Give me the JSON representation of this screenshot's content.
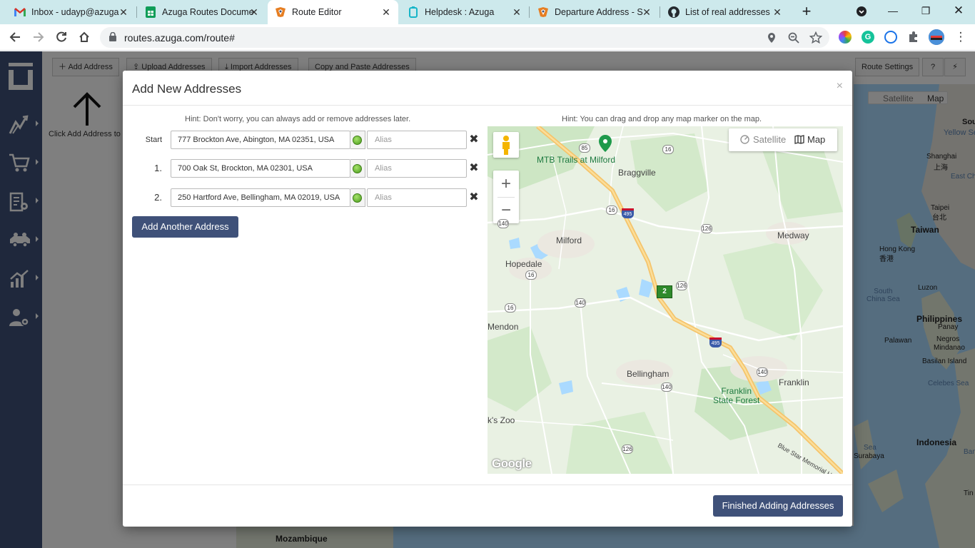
{
  "browser": {
    "tabs": [
      {
        "title": "Inbox - udayp@azuga",
        "icon": "gmail-icon",
        "color": "#d93025"
      },
      {
        "title": "Azuga Routes Docume",
        "icon": "sheets-icon",
        "color": "#0f9d58"
      },
      {
        "title": "Route Editor",
        "icon": "azuga-icon",
        "color": "#e67e22"
      },
      {
        "title": "Helpdesk : Azuga",
        "icon": "helpdesk-icon",
        "color": "#17b5c8"
      },
      {
        "title": "Departure Address - S",
        "icon": "azuga-icon",
        "color": "#e67e22"
      },
      {
        "title": "List of real addresses",
        "icon": "github-icon",
        "color": "#24292e"
      }
    ],
    "url": "routes.azuga.com/route#"
  },
  "app": {
    "toolbar": {
      "add_address": "Add Address",
      "upload_addresses": "Upload Addresses",
      "import_addresses": "Import Addresses",
      "copy_paste": "Copy and Paste Addresses",
      "route_settings": "Route Settings",
      "help": "?",
      "flash": "⚡"
    },
    "hint_left": "Click Add Address to",
    "bg_map": {
      "satellite": "Satellite",
      "map": "Map",
      "labels": {
        "south": "Sout",
        "yellow_sea": "Yellow Sea",
        "shanghai": "Shanghai",
        "shanghai_cn": "上海",
        "east_china": "East China",
        "taipei": "Taipei",
        "taipei_cn": "台北",
        "taiwan": "Taiwan",
        "hong_kong": "Hong Kong",
        "hong_kong_cn": "香港",
        "south_china_sea": "South\nChina Sea",
        "luzon": "Luzon",
        "philippines": "Philippines",
        "panay": "Panay",
        "palawan": "Palawan",
        "negros": "Negros",
        "mindanao": "Mindanao",
        "basilan": "Basilan Island",
        "celebes": "Celebes Sea",
        "sea": "Sea",
        "surabaya": "Surabaya",
        "indonesia": "Indonesia",
        "banda": "Banda",
        "tin": "Tin",
        "mozambique": "Mozambique"
      }
    }
  },
  "modal": {
    "title": "Add New Addresses",
    "close": "×",
    "hint_left": "Hint: Don't worry, you can always add or remove addresses later.",
    "hint_right": "Hint: You can drag and drop any map marker on the map.",
    "rows": [
      {
        "label": "Start",
        "address": "777 Brockton Ave, Abington, MA 02351, USA",
        "alias_placeholder": "Alias"
      },
      {
        "label": "1.",
        "address": "700 Oak St, Brockton, MA 02301, USA",
        "alias_placeholder": "Alias"
      },
      {
        "label": "2.",
        "address": "250 Hartford Ave, Bellingham, MA 02019, USA",
        "alias_placeholder": "Alias"
      }
    ],
    "add_another": "Add Another Address",
    "finished": "Finished Adding Addresses"
  },
  "map": {
    "satellite": "Satellite",
    "map": "Map",
    "zoom_in": "+",
    "zoom_out": "−",
    "google": "Google",
    "marker_label": "2",
    "places": {
      "mtb": "MTB Trails at Milford",
      "braggville": "Braggville",
      "milford": "Milford",
      "medway": "Medway",
      "hopedale": "Hopedale",
      "mendon": "Mendon",
      "bellingham": "Bellingham",
      "franklin": "Franklin",
      "franklin_forest": "Franklin\nState Forest",
      "zoo": "k's Zoo",
      "bluestar": "Blue Star Memorial Hwy"
    },
    "shields": {
      "r85": "85",
      "r16a": "16",
      "r16b": "16",
      "r16c": "16",
      "r16d": "16",
      "r140a": "140",
      "r140b": "140",
      "r140c": "140",
      "r140d": "140",
      "r126a": "126",
      "r126b": "126",
      "r126c": "126",
      "i495a": "495",
      "i495b": "495"
    }
  },
  "colors": {
    "nav": "#3f5179",
    "button": "#3f5179",
    "tabbar": "#cde9ec",
    "status_green": "#4a9b1c",
    "marker": "#2f8a2b"
  }
}
